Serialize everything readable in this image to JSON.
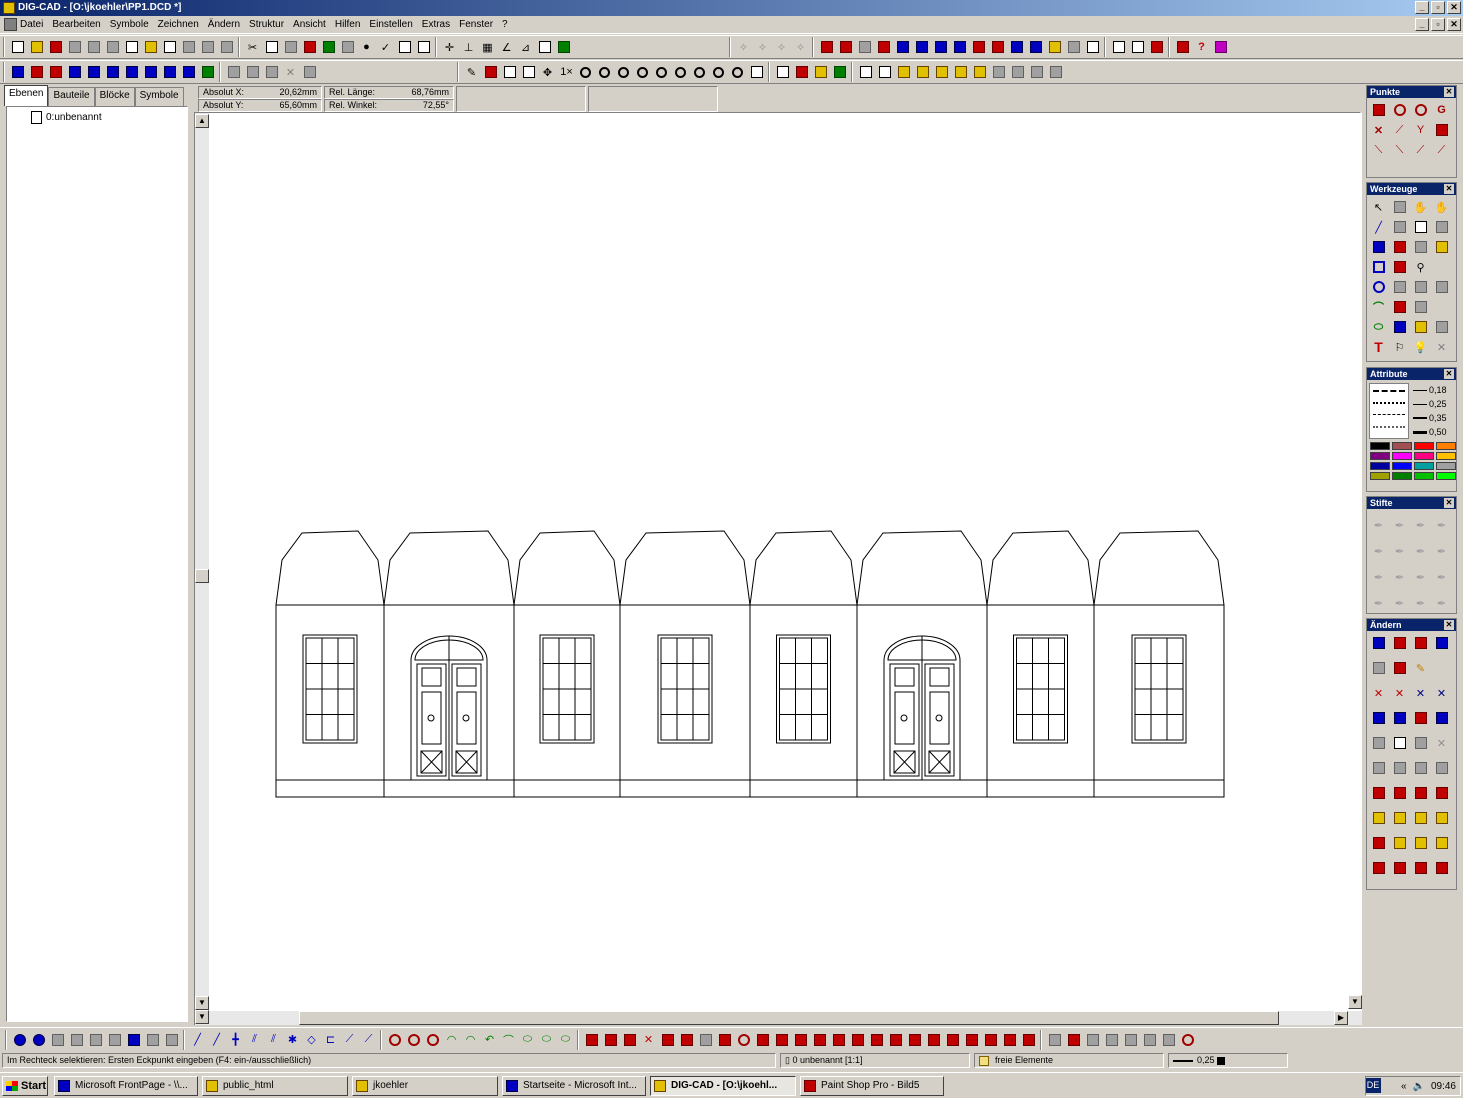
{
  "window": {
    "title": "DIG-CAD - [O:\\jkoehler\\PP1.DCD *]"
  },
  "menu": [
    "Datei",
    "Bearbeiten",
    "Symbole",
    "Zeichnen",
    "Ändern",
    "Struktur",
    "Ansicht",
    "Hilfen",
    "Einstellen",
    "Extras",
    "Fenster",
    "?"
  ],
  "left_panel": {
    "tabs": [
      "Ebenen",
      "Bauteile",
      "Blöcke",
      "Symbole"
    ],
    "tree_item": "0:unbenannt"
  },
  "coords": {
    "abs_x_label": "Absolut X:",
    "abs_x": "20,62mm",
    "abs_y_label": "Absolut Y:",
    "abs_y": "65,60mm",
    "rel_len_label": "Rel. Länge:",
    "rel_len": "68,76mm",
    "rel_angle_label": "Rel. Winkel:",
    "rel_angle": "72,55°"
  },
  "palettes": {
    "punkte": "Punkte",
    "werkzeuge": "Werkzeuge",
    "attribute": "Attribute",
    "line_widths": [
      "0,18",
      "0,25",
      "0,35",
      "0,50"
    ],
    "stifte": "Stifte",
    "aendern": "Ändern"
  },
  "colors": [
    "#000000",
    "#a05050",
    "#ff0000",
    "#ff8000",
    "#800080",
    "#ff00ff",
    "#ff0080",
    "#ffc000",
    "#0000a0",
    "#0000ff",
    "#00a0a0",
    "#a0a0a0",
    "#a0a000",
    "#008000",
    "#00c000",
    "#00ff00"
  ],
  "status": {
    "message": "Im Rechteck selektieren: Ersten Eckpunkt eingeben (F4: ein-/ausschließlich)",
    "layer": "0 unbenannt [1:1]",
    "group": "freie Elemente",
    "linewidth": "0,25"
  },
  "taskbar": {
    "start": "Start",
    "tasks": [
      "Microsoft FrontPage - \\\\...",
      "public_html",
      "jkoehler",
      "Startseite - Microsoft Int...",
      "DIG-CAD - [O:\\jkoehl...",
      "Paint Shop Pro - Bild5"
    ],
    "lang": "DE",
    "clock": "09:46"
  }
}
